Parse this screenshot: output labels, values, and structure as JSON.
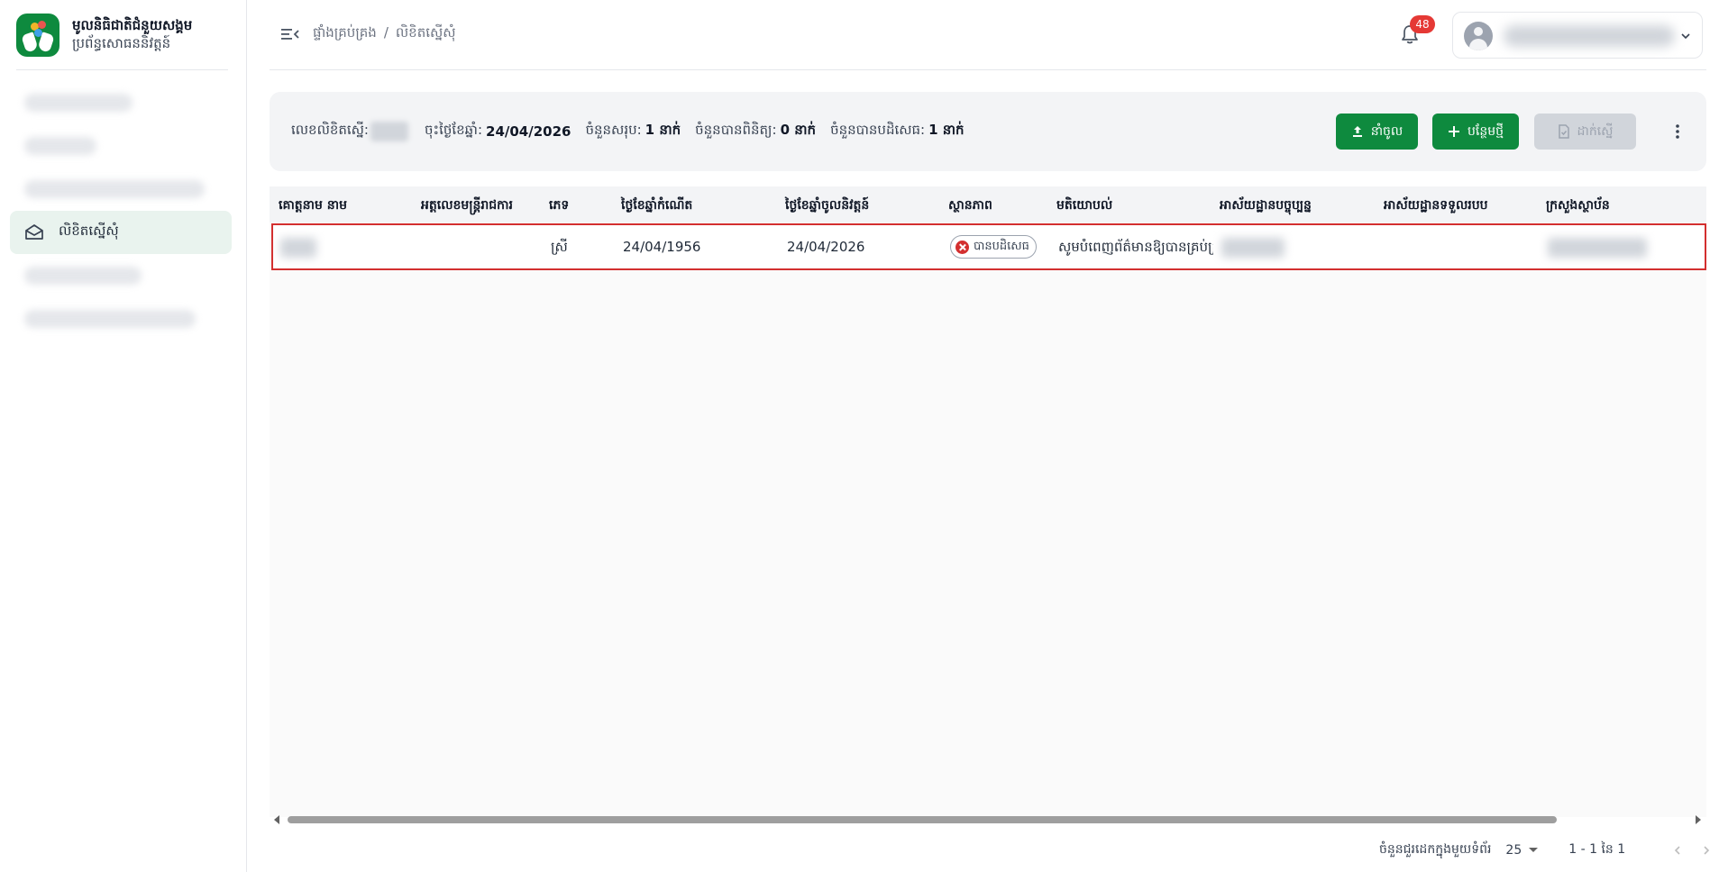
{
  "brand": {
    "title": "មូលនិធិជាតិជំនួយសង្គម",
    "subtitle": "ប្រព័ន្ធសោធននិវត្តន៍"
  },
  "sidebar": {
    "active_label": "លិខិតស្នើសុំ"
  },
  "breadcrumb": {
    "root": "ផ្ទាំងគ្រប់គ្រង",
    "separator": "/",
    "current": "លិខិតស្នើសុំ"
  },
  "notifications": {
    "count": "48"
  },
  "toolbar": {
    "letter_no_label": "លេខលិខិតស្នើ:",
    "date_label": "ចុះថ្ងៃខែឆ្នាំ:",
    "date_value": "24/04/2026",
    "total_label": "ចំនួនសរុប:",
    "total_value": "1 នាក់",
    "verified_label": "ចំនួនបានពិនិត្យ:",
    "verified_value": "0 នាក់",
    "rejected_label": "ចំនួនបានបដិសេធ:",
    "rejected_value": "1 នាក់",
    "import_label": "នាំចូល",
    "add_label": "បន្ថែមថ្មី",
    "submit_label": "ដាក់ស្នើ",
    "accent": "#0e8a3e"
  },
  "table": {
    "columns": [
      "គោត្តនាម នាម",
      "អត្តលេខមន្ត្រីរាជការ",
      "ភេទ",
      "ថ្ងៃខែឆ្នាំកំណើត",
      "ថ្ងៃខែឆ្នាំចូលនិវត្តន៍",
      "ស្ថានភាព",
      "មតិយោបល់",
      "អាស័យដ្ឋានបច្ចុប្បន្ន",
      "អាស័យដ្ឋានទទួលរបប",
      "ក្រសួងស្ថាប័ន"
    ],
    "rows": [
      {
        "gender": "ស្រី",
        "dob": "24/04/1956",
        "retire_date": "24/04/2026",
        "status": "បានបដិសេធ",
        "comment": "សូមបំពេញព័ត៌មានឱ្យបានគ្រប់គ្រាន់"
      }
    ],
    "status_color": "#d32f2f"
  },
  "pagination": {
    "rows_per_page_label": "ចំនួនជួរដេកក្នុងមួយទំព័រ",
    "rows_per_page": "25",
    "range": "1 - 1 នៃ 1"
  }
}
